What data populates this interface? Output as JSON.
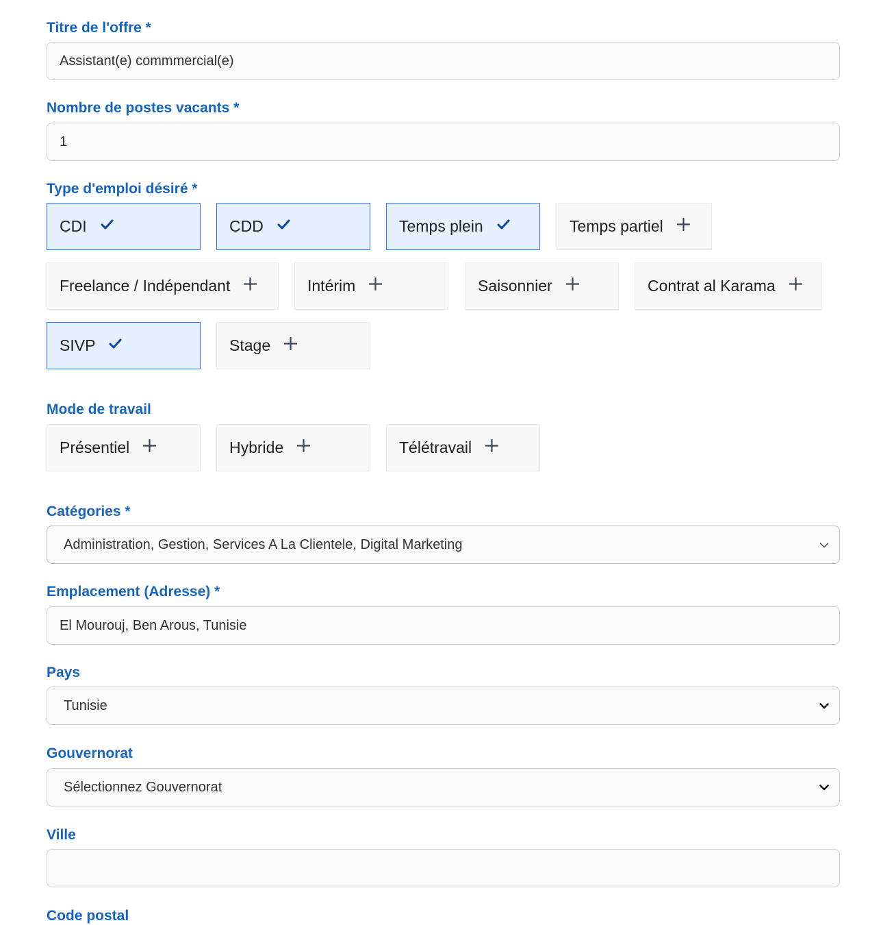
{
  "form": {
    "title": {
      "label": "Titre de l'offre *",
      "value": "Assistant(e) commmercial(e)"
    },
    "vacancies": {
      "label": "Nombre de postes vacants *",
      "value": "1"
    },
    "job_type": {
      "label": "Type d'emploi désiré *",
      "options": [
        {
          "label": "CDI",
          "selected": true
        },
        {
          "label": "CDD",
          "selected": true
        },
        {
          "label": "Temps plein",
          "selected": true
        },
        {
          "label": "Temps partiel",
          "selected": false
        },
        {
          "label": "Freelance / Indépendant",
          "selected": false
        },
        {
          "label": "Intérim",
          "selected": false
        },
        {
          "label": "Saisonnier",
          "selected": false
        },
        {
          "label": "Contrat al Karama",
          "selected": false
        },
        {
          "label": "SIVP",
          "selected": true
        },
        {
          "label": "Stage",
          "selected": false
        }
      ]
    },
    "work_mode": {
      "label": "Mode de travail",
      "options": [
        {
          "label": "Présentiel",
          "selected": false
        },
        {
          "label": "Hybride",
          "selected": false
        },
        {
          "label": "Télétravail",
          "selected": false
        }
      ]
    },
    "categories": {
      "label": "Catégories *",
      "value": "Administration, Gestion, Services A La Clientele, Digital Marketing"
    },
    "address": {
      "label": "Emplacement (Adresse) *",
      "value": "El Mourouj, Ben Arous, Tunisie"
    },
    "country": {
      "label": "Pays",
      "value": "Tunisie"
    },
    "governorate": {
      "label": "Gouvernorat",
      "value": "Sélectionnez Gouvernorat"
    },
    "city": {
      "label": "Ville",
      "value": ""
    },
    "postal_code": {
      "label": "Code postal"
    }
  },
  "colors": {
    "label": "#1565c0",
    "selected_bg": "#e6effd",
    "selected_border": "#3b6fd0",
    "check": "#0d47a1",
    "plus": "#3a4557"
  },
  "icons": {
    "selected": "check-icon",
    "unselected": "plus-icon",
    "dropdown": "chevron-down-icon"
  }
}
